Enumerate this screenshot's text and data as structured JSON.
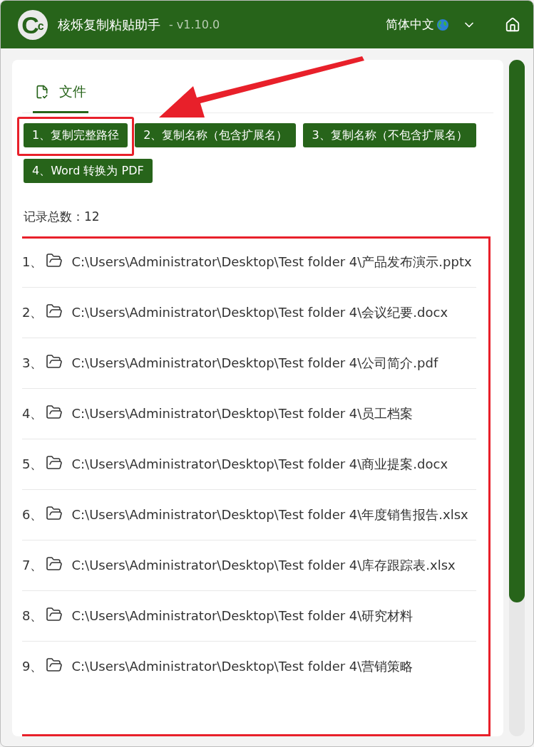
{
  "header": {
    "logo": {
      "big": "C",
      "small": "c"
    },
    "title": "核烁复制粘贴助手",
    "version": "- v1.10.0",
    "language": "简体中文"
  },
  "tabs": [
    {
      "label": "文件",
      "selected": true
    }
  ],
  "actions": [
    {
      "label": "1、复制完整路径",
      "highlighted": true
    },
    {
      "label": "2、复制名称（包含扩展名）",
      "highlighted": false
    },
    {
      "label": "3、复制名称（不包含扩展名）",
      "highlighted": false
    },
    {
      "label": "4、Word 转换为 PDF",
      "highlighted": false
    }
  ],
  "record_count": "记录总数：12",
  "records": {
    "highlighted": true,
    "items": [
      {
        "index": "1、",
        "path": "C:\\Users\\Administrator\\Desktop\\Test folder 4\\产品发布演示.pptx"
      },
      {
        "index": "2、",
        "path": "C:\\Users\\Administrator\\Desktop\\Test folder 4\\会议纪要.docx"
      },
      {
        "index": "3、",
        "path": "C:\\Users\\Administrator\\Desktop\\Test folder 4\\公司简介.pdf"
      },
      {
        "index": "4、",
        "path": "C:\\Users\\Administrator\\Desktop\\Test folder 4\\员工档案"
      },
      {
        "index": "5、",
        "path": "C:\\Users\\Administrator\\Desktop\\Test folder 4\\商业提案.docx"
      },
      {
        "index": "6、",
        "path": "C:\\Users\\Administrator\\Desktop\\Test folder 4\\年度销售报告.xlsx"
      },
      {
        "index": "7、",
        "path": "C:\\Users\\Administrator\\Desktop\\Test folder 4\\库存跟踪表.xlsx"
      },
      {
        "index": "8、",
        "path": "C:\\Users\\Administrator\\Desktop\\Test folder 4\\研究材料"
      },
      {
        "index": "9、",
        "path": "C:\\Users\\Administrator\\Desktop\\Test folder 4\\营销策略"
      }
    ]
  },
  "callout_arrow": true
}
